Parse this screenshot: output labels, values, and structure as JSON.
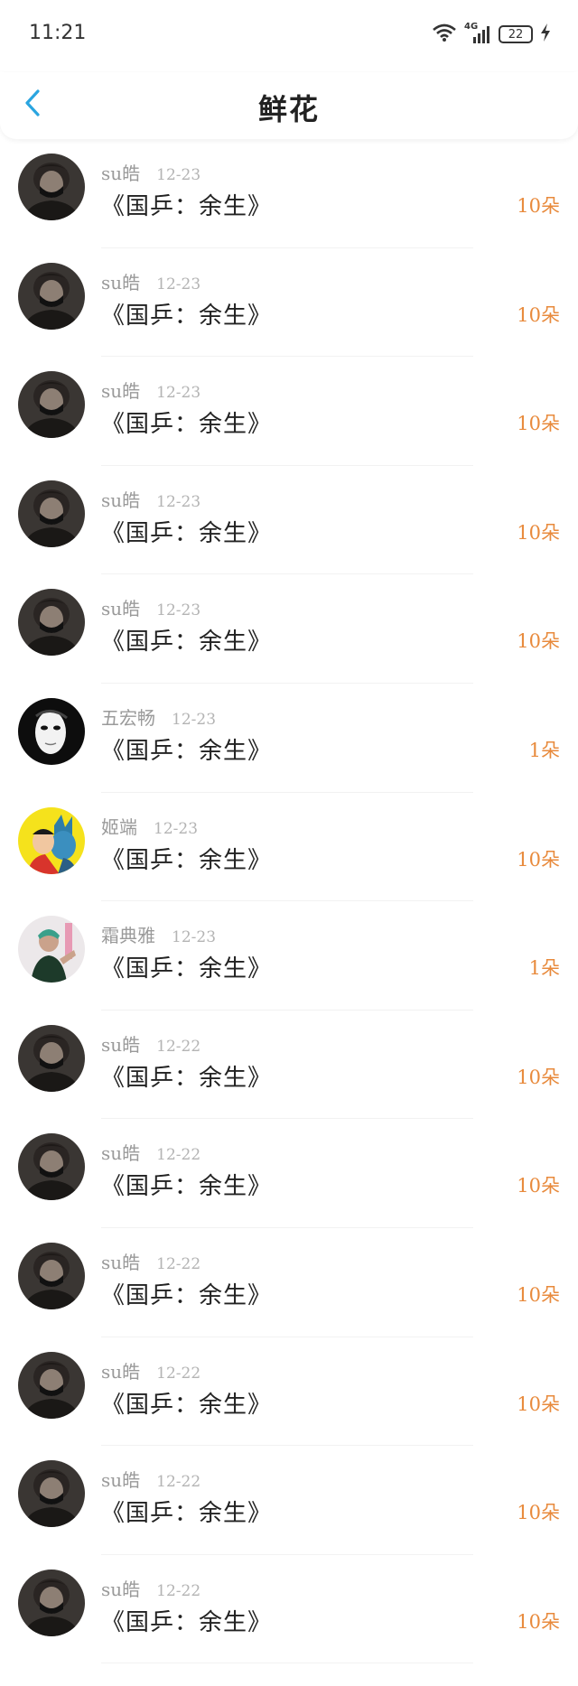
{
  "status_bar": {
    "time": "11:21",
    "network": "4G",
    "battery": "22",
    "icons": [
      "wifi-icon",
      "signal-icon",
      "battery-icon",
      "charging-icon"
    ]
  },
  "header": {
    "title": "鲜花",
    "back_icon": "chevron-left-icon",
    "accent_color": "#2aa5e0"
  },
  "rows": [
    {
      "name": "su皓",
      "date": "12-23",
      "title": "《国乒：余生》",
      "amount": "10朵",
      "avatar": "dark"
    },
    {
      "name": "su皓",
      "date": "12-23",
      "title": "《国乒：余生》",
      "amount": "10朵",
      "avatar": "dark"
    },
    {
      "name": "su皓",
      "date": "12-23",
      "title": "《国乒：余生》",
      "amount": "10朵",
      "avatar": "dark"
    },
    {
      "name": "su皓",
      "date": "12-23",
      "title": "《国乒：余生》",
      "amount": "10朵",
      "avatar": "dark"
    },
    {
      "name": "su皓",
      "date": "12-23",
      "title": "《国乒：余生》",
      "amount": "10朵",
      "avatar": "dark"
    },
    {
      "name": "五宏畅",
      "date": "12-23",
      "title": "《国乒：余生》",
      "amount": "1朵",
      "avatar": "mask"
    },
    {
      "name": "姬端",
      "date": "12-23",
      "title": "《国乒：余生》",
      "amount": "10朵",
      "avatar": "comic"
    },
    {
      "name": "霜典雅",
      "date": "12-23",
      "title": "《国乒：余生》",
      "amount": "1朵",
      "avatar": "light"
    },
    {
      "name": "su皓",
      "date": "12-22",
      "title": "《国乒：余生》",
      "amount": "10朵",
      "avatar": "dark"
    },
    {
      "name": "su皓",
      "date": "12-22",
      "title": "《国乒：余生》",
      "amount": "10朵",
      "avatar": "dark"
    },
    {
      "name": "su皓",
      "date": "12-22",
      "title": "《国乒：余生》",
      "amount": "10朵",
      "avatar": "dark"
    },
    {
      "name": "su皓",
      "date": "12-22",
      "title": "《国乒：余生》",
      "amount": "10朵",
      "avatar": "dark"
    },
    {
      "name": "su皓",
      "date": "12-22",
      "title": "《国乒：余生》",
      "amount": "10朵",
      "avatar": "dark"
    },
    {
      "name": "su皓",
      "date": "12-22",
      "title": "《国乒：余生》",
      "amount": "10朵",
      "avatar": "dark"
    }
  ],
  "colors": {
    "amount": "#e88a3c",
    "name": "#9a9a9a",
    "date": "#b4b4b4"
  }
}
